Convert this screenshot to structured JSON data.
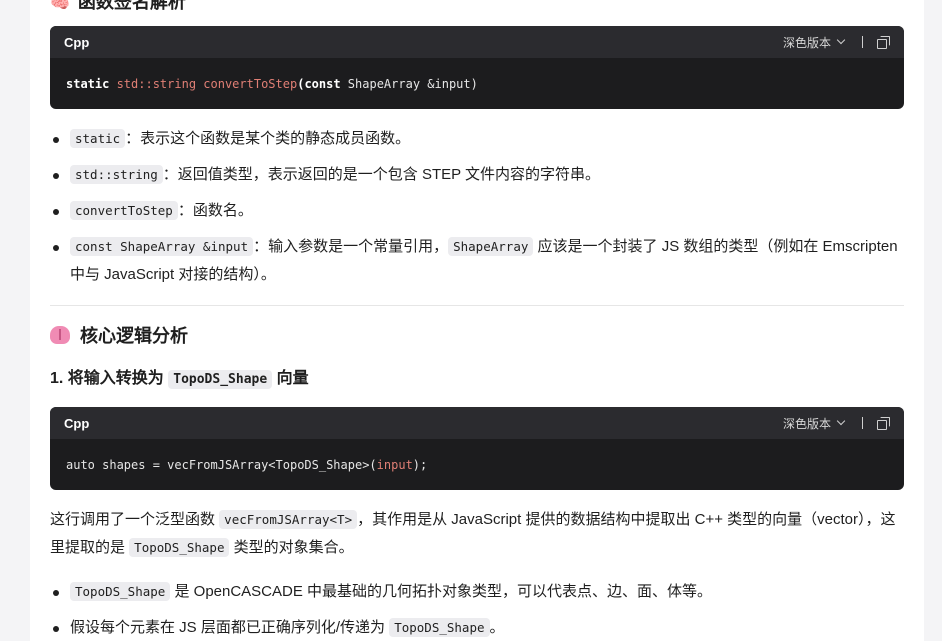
{
  "top_heading": {
    "emoji_label": "🧠",
    "text": "函数签名解析"
  },
  "code_blocks": [
    {
      "lang": "Cpp",
      "theme_label": "深色版本",
      "tokens": {
        "t1": "static ",
        "t2": "std::string ",
        "t3": "convertToStep",
        "t4": "(",
        "t5": "const ",
        "t6": "ShapeArray &input)"
      }
    },
    {
      "lang": "Cpp",
      "theme_label": "深色版本",
      "tokens": {
        "t1": "auto shapes = vecFromJSArray<TopoDS_Shape>(",
        "t2": "input",
        "t3": ");"
      }
    }
  ],
  "sig_bullets": [
    {
      "code": "static",
      "text": "：表示这个函数是某个类的静态成员函数。"
    },
    {
      "code": "std::string",
      "text": "：返回值类型，表示返回的是一个包含 STEP 文件内容的字符串。"
    },
    {
      "code": "convertToStep",
      "text": "：函数名。"
    },
    {
      "code": "const ShapeArray &input",
      "text": "：输入参数是一个常量引用，",
      "code2": "ShapeArray",
      "text2": " 应该是一个封装了 JS 数组的类型（例如在 Emscripten 中与 JavaScript 对接的结构）。"
    }
  ],
  "section": {
    "title": "核心逻辑分析"
  },
  "step": {
    "prefix": "1. 将输入转换为 ",
    "code": "TopoDS_Shape",
    "suffix": " 向量"
  },
  "para": {
    "p1": "这行调用了一个泛型函数 ",
    "code1": "vecFromJSArray<T>",
    "p2": "，其作用是从 JavaScript 提供的数据结构中提取出 C++ 类型的向量（vector），这里提取的是 ",
    "code2": "TopoDS_Shape",
    "p3": " 类型的对象集合。"
  },
  "shape_bullets": [
    {
      "code": "TopoDS_Shape",
      "text": " 是 OpenCASCADE 中最基础的几何拓扑对象类型，可以代表点、边、面、体等。"
    },
    {
      "pre": "假设每个元素在 JS 层面都已正确序列化/传递为 ",
      "code": "TopoDS_Shape",
      "text": "。"
    }
  ]
}
